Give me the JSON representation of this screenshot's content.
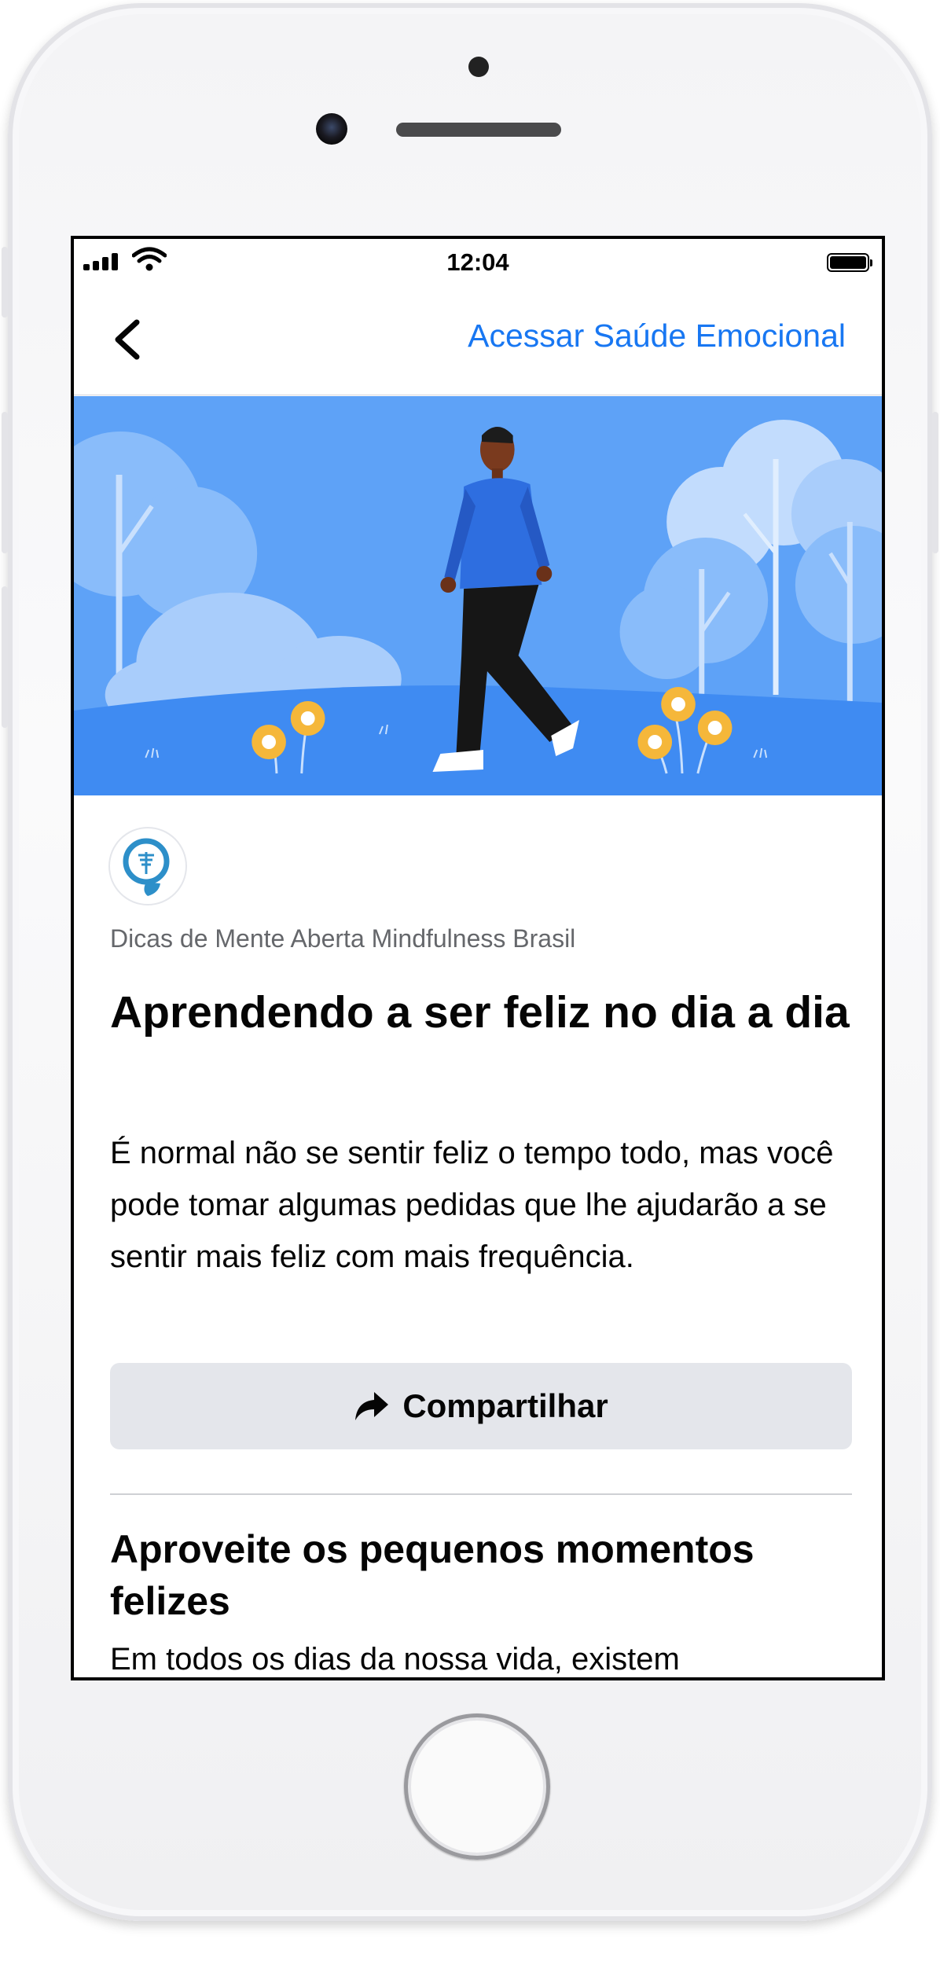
{
  "status_bar": {
    "time": "12:04"
  },
  "nav": {
    "back_label": "<",
    "link_text": "Acessar Saúde Emocional"
  },
  "article": {
    "publisher": "Dicas de Mente Aberta Mindfulness Brasil",
    "title": "Aprendendo a ser feliz no dia a dia",
    "intro": "É normal não se sentir feliz o tempo todo, mas você pode tomar algumas pedidas que lhe ajudarão a se sentir mais feliz com mais frequência.",
    "share_label": "Compartilhar",
    "section_title": "Aproveite os pequenos momentos felizes",
    "section_body": "Em todos os dias da nossa vida, existem"
  },
  "colors": {
    "accent": "#1877f2",
    "hero_sky": "#5ea2f7",
    "share_bg": "#e4e6eb"
  },
  "icons": [
    "signal-icon",
    "wifi-icon",
    "battery-icon",
    "chevron-left-icon",
    "share-arrow-icon",
    "publisher-logo"
  ]
}
